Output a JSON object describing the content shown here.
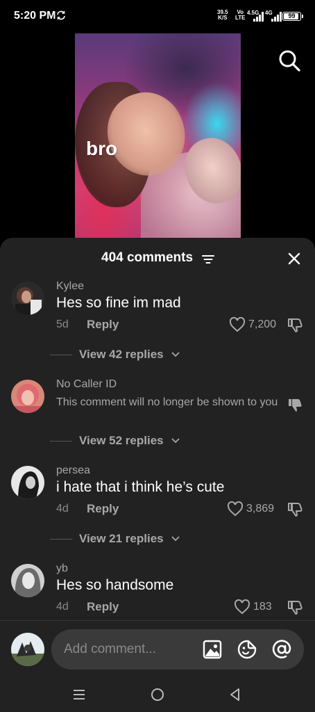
{
  "status_bar": {
    "time": "5:20 PM",
    "net_speed_value": "39.5",
    "net_speed_unit": "K/S",
    "volte_top": "Vo",
    "volte_bottom": "LTE",
    "signal1_label": "4.5G",
    "signal2_label": "4G",
    "battery": "99"
  },
  "video": {
    "caption": "bro"
  },
  "sheet": {
    "title": "404 comments"
  },
  "comments": [
    {
      "username": "Kylee",
      "text": "Hes so fine im mad",
      "time": "5d",
      "reply": "Reply",
      "likes": "7,200",
      "view_replies": "View 42 replies"
    },
    {
      "username": "No Caller ID",
      "text": "This comment will no longer be shown to you",
      "view_replies": "View 52 replies"
    },
    {
      "username": "persea",
      "text": "i hate that i think he’s cute",
      "time": "4d",
      "reply": "Reply",
      "likes": "3,869",
      "view_replies": "View 21 replies"
    },
    {
      "username": "yb",
      "text": "Hes so handsome",
      "time": "4d",
      "reply": "Reply",
      "likes": "183"
    }
  ],
  "input": {
    "placeholder": "Add comment..."
  },
  "colors": {
    "sheet_bg": "#222222",
    "input_bg": "#3a3a3a",
    "muted_text": "#a8a8a8"
  },
  "icons": {
    "search": "search-icon",
    "filter": "filter-icon",
    "close": "close-icon",
    "heart": "heart-icon",
    "dislike": "dislike-icon",
    "image": "image-icon",
    "emoji": "emoji-icon",
    "mention": "at-mention-icon"
  }
}
